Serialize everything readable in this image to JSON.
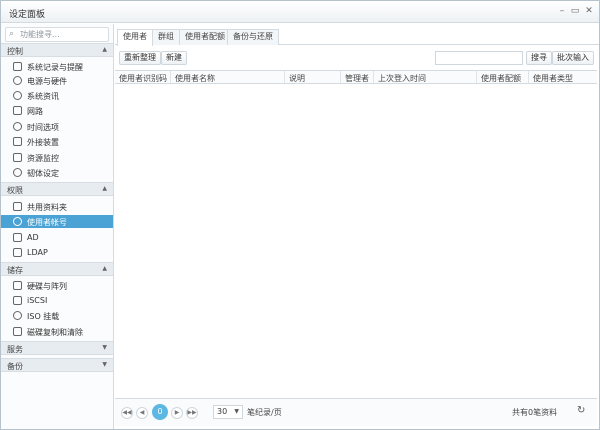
{
  "window": {
    "title": "设定面板",
    "controls": [
      "–",
      "▭",
      "✕"
    ]
  },
  "sidebar": {
    "search_placeholder": "功能搜寻...",
    "sections": [
      {
        "label": "控制",
        "items": [
          {
            "label": "系统记录与提醒",
            "icon": "log-icon"
          },
          {
            "label": "电源与硬件",
            "icon": "power-icon"
          },
          {
            "label": "系统资讯",
            "icon": "info-icon"
          },
          {
            "label": "网路",
            "icon": "network-icon"
          },
          {
            "label": "时间选项",
            "icon": "clock-icon"
          },
          {
            "label": "外接装置",
            "icon": "usb-icon"
          },
          {
            "label": "资源监控",
            "icon": "monitor-icon"
          },
          {
            "label": "韧体设定",
            "icon": "firmware-icon"
          }
        ]
      },
      {
        "label": "权限",
        "items": [
          {
            "label": "共用资料夹",
            "icon": "folder-icon"
          },
          {
            "label": "使用者帐号",
            "icon": "user-icon",
            "active": true
          },
          {
            "label": "AD",
            "icon": "ad-icon"
          },
          {
            "label": "LDAP",
            "icon": "ldap-icon"
          }
        ]
      },
      {
        "label": "储存",
        "items": [
          {
            "label": "硬碟与阵列",
            "icon": "disk-icon"
          },
          {
            "label": "iSCSI",
            "icon": "iscsi-icon"
          },
          {
            "label": "ISO 挂载",
            "icon": "iso-icon"
          },
          {
            "label": "磁碟复制和清除",
            "icon": "broom-icon"
          }
        ]
      },
      {
        "label": "服务",
        "items": []
      },
      {
        "label": "备份",
        "items": []
      }
    ]
  },
  "tabs": [
    "使用者",
    "群组",
    "使用者配额",
    "备份与还原"
  ],
  "toolbar": {
    "refresh_label": "重新整理",
    "create_label": "新建",
    "search_label": "搜寻",
    "batch_label": "批次输入"
  },
  "table": {
    "columns": [
      "使用者识别码",
      "使用者名称",
      "说明",
      "管理者",
      "上次登入时间",
      "使用者配额",
      "使用者类型"
    ]
  },
  "pager": {
    "current_page": "0",
    "page_size": "30",
    "per_page_label": "笔纪录/页",
    "total_label": "共有0笔资料"
  }
}
